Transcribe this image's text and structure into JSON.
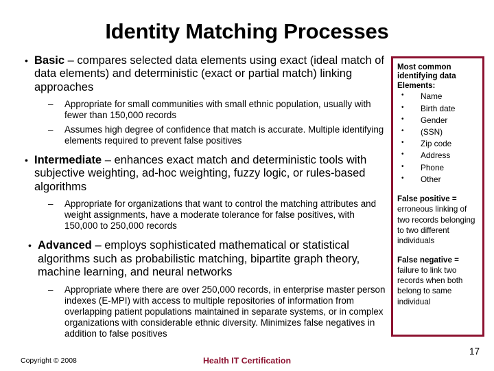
{
  "slide": {
    "title": "Identity Matching Processes",
    "number": "17"
  },
  "markers": {
    "bullet": "•",
    "dash": "–",
    "side_bullet": "•"
  },
  "body": {
    "blocks": [
      {
        "lead": "Basic",
        "dash": "–",
        "text": " compares selected data elements using exact (ideal match of data elements) and deterministic (exact or partial match) linking approaches",
        "subs": [
          "Appropriate for small communities with small ethnic population, usually with fewer than 150,000 records",
          "Assumes high degree of confidence that match is accurate. Multiple identifying elements required to prevent false positives"
        ]
      },
      {
        "lead": "Intermediate",
        "dash": "–",
        "text": " enhances exact match and deterministic tools with subjective weighting, ad-hoc weighting, fuzzy logic, or rules-based algorithms",
        "subs": [
          "Appropriate for organizations that want to control the matching attributes and weight assignments, have a moderate tolerance for false positives, with 150,000 to 250,000 records"
        ]
      },
      {
        "lead": "Advanced",
        "dash": "–",
        "text": " employs sophisticated mathematical or statistical algorithms such as probabilistic matching, bipartite graph theory, machine learning, and neural networks",
        "subs": [
          "Appropriate where there are over 250,000 records, in enterprise master person indexes (E-MPI) with access to multiple repositories of information from overlapping patient populations maintained in separate systems, or in complex organizations with considerable ethnic diversity. Minimizes false negatives in addition to false positives"
        ]
      }
    ]
  },
  "sidebar": {
    "heading": "Most common identifying data Elements:",
    "elements": [
      "Name",
      "Birth date",
      "Gender",
      "(SSN)",
      "Zip code",
      "Address",
      "Phone",
      "Other"
    ],
    "definitions": [
      {
        "term": "False positive =",
        "body": "erroneous linking of two records belonging to two different individuals"
      },
      {
        "term": "False negative =",
        "body": "failure to link two records when both belong to same individual"
      }
    ]
  },
  "footer": {
    "copyright": "Copyright © 2008",
    "brand": "Health IT Certification"
  },
  "colors": {
    "accent": "#8C1230",
    "text": "#000000",
    "background": "#FFFFFF"
  }
}
